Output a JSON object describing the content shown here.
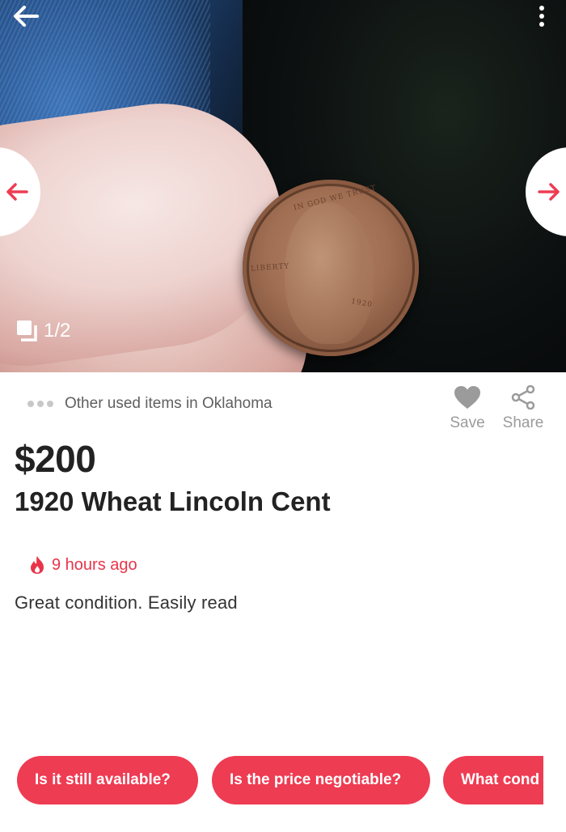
{
  "gallery": {
    "counter": "1/2",
    "coin_inscription_liberty": "LIBERTY",
    "coin_inscription_motto": "IN GOD WE TRUST",
    "coin_inscription_year": "1920"
  },
  "listing": {
    "category": "Other used items in Oklahoma",
    "price": "$200",
    "title": "1920 Wheat Lincoln Cent",
    "posted": "9 hours ago",
    "description": "Great condition.  Easily read"
  },
  "actions": {
    "save_label": "Save",
    "share_label": "Share"
  },
  "quick_replies": [
    {
      "label": "Is it still available?"
    },
    {
      "label": "Is the price negotiable?"
    },
    {
      "label": "What cond"
    }
  ],
  "colors": {
    "accent": "#ee3c53",
    "muted_text": "#9b9b9b",
    "primary_text": "#222222"
  }
}
